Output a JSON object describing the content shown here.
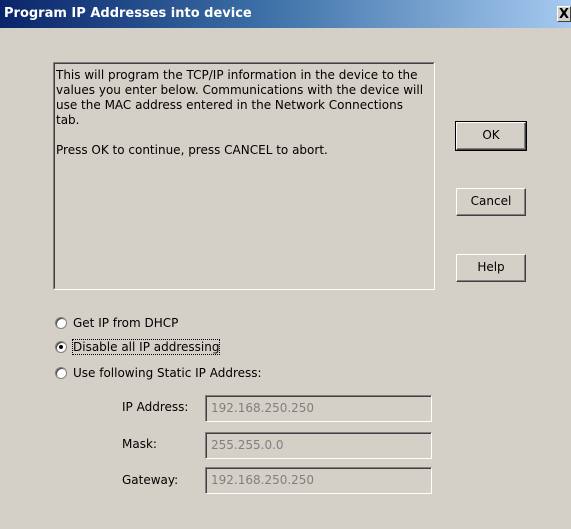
{
  "window": {
    "title": "Program IP Addresses into device",
    "close_glyph": "X"
  },
  "info": {
    "paragraph1": "This will program the TCP/IP information in the device to the values you enter below. Communications with the device will use the MAC address entered in the Network Connections tab.",
    "paragraph2": "Press OK to continue, press CANCEL to abort."
  },
  "buttons": {
    "ok": "OK",
    "cancel": "Cancel",
    "help": "Help"
  },
  "radios": [
    {
      "label": "Get IP from DHCP",
      "selected": false
    },
    {
      "label": "Disable all IP addressing",
      "selected": true
    },
    {
      "label": "Use following Static IP Address:",
      "selected": false
    }
  ],
  "fields": {
    "ip_label": "IP Address:",
    "ip_value": "192.168.250.250",
    "mask_label": "Mask:",
    "mask_value": "255.255.0.0",
    "gateway_label": "Gateway:",
    "gateway_value": "192.168.250.250"
  }
}
